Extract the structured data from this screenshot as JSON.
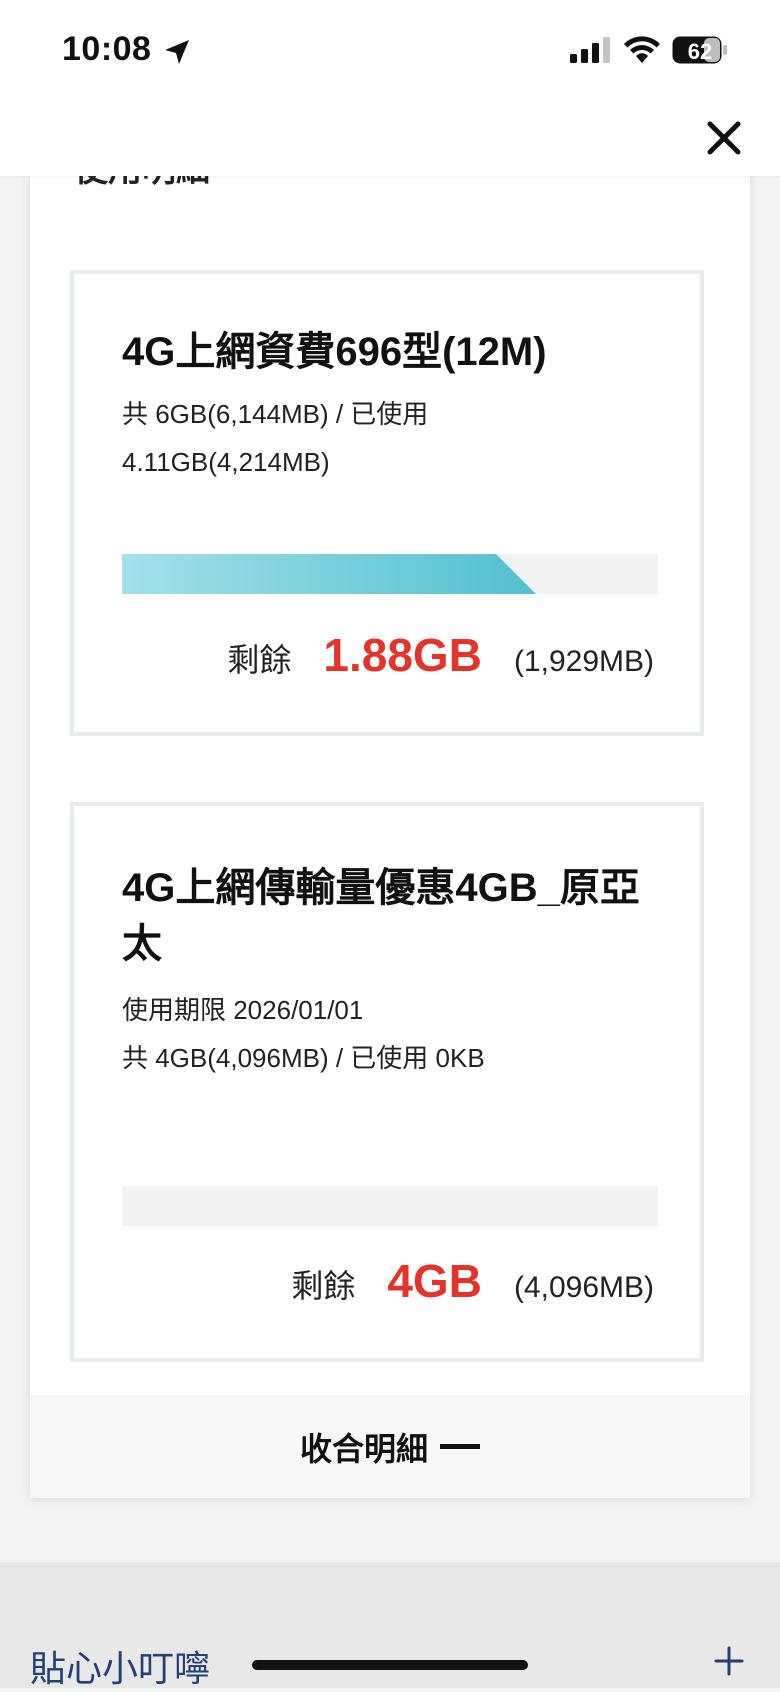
{
  "status_bar": {
    "time": "10:08",
    "battery": "62",
    "icons": [
      "location-arrow-icon",
      "cellular-signal-icon",
      "wifi-icon",
      "battery-icon"
    ]
  },
  "header": {
    "close_icon": "close-icon"
  },
  "panel": {
    "cut_heading": "使用明細",
    "cards": [
      {
        "title": "4G上網資費696型(12M)",
        "lines": [
          "共 6GB(6,144MB) / 已使用",
          "4.11GB(4,214MB)"
        ],
        "usage_fraction": 0.69,
        "remain_label": "剩餘",
        "remain_value": "1.88GB",
        "remain_mb": "(1,929MB)"
      },
      {
        "title": "4G上網傳輸量優惠4GB_原亞太",
        "lines": [
          "使用期限 2026/01/01",
          "共 4GB(4,096MB) / 已使用 0KB"
        ],
        "usage_fraction": 0,
        "remain_label": "剩餘",
        "remain_value": "4GB",
        "remain_mb": "(4,096MB)"
      }
    ],
    "collapse_label": "收合明細"
  },
  "bottom": {
    "tips_label": "貼心小叮嚀"
  },
  "colors": {
    "accent_red": "#e3332b",
    "bar_start": "#a3e0ea",
    "bar_end": "#52c0d0",
    "link_blue": "#233f73"
  }
}
